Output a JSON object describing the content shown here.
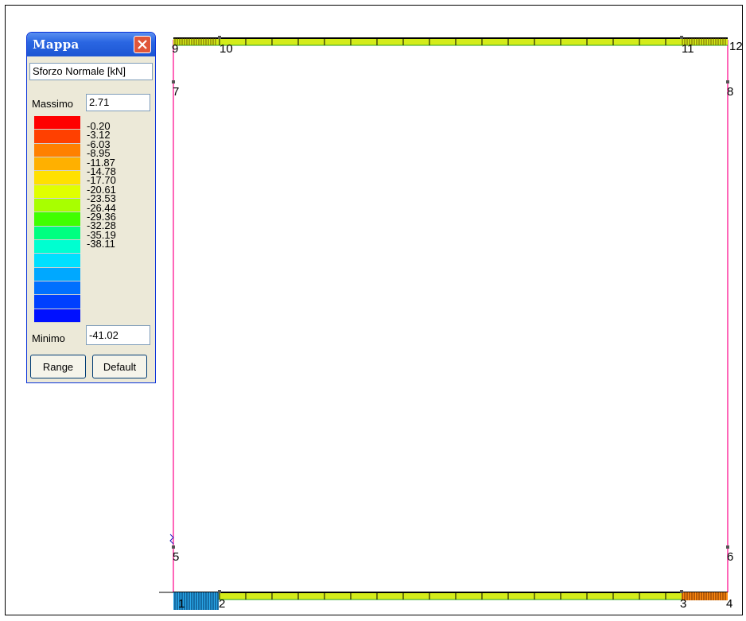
{
  "nodes": [
    "9",
    "10",
    "11",
    "12",
    "7",
    "8",
    "5",
    "6",
    "1",
    "2",
    "3",
    "4"
  ],
  "panel": {
    "title": "Mappa",
    "quantity": "Sforzo Normale [kN]",
    "max_label": "Massimo",
    "max_value": "2.71",
    "min_label": "Minimo",
    "min_value": "-41.02",
    "range_button": "Range",
    "default_button": "Default",
    "scale_values": [
      "-0.20",
      "-3.12",
      "-6.03",
      "-8.95",
      "-11.87",
      "-14.78",
      "-17.70",
      "-20.61",
      "-23.53",
      "-26.44",
      "-29.36",
      "-32.28",
      "-35.19",
      "-38.11"
    ],
    "scale_colors": [
      "#ff0000",
      "#ff4000",
      "#ff8000",
      "#ffb000",
      "#ffe000",
      "#e0ff00",
      "#a8ff00",
      "#40ff00",
      "#00ff80",
      "#00ffd0",
      "#00e0ff",
      "#00a8ff",
      "#0070ff",
      "#0040ff",
      "#0010ff"
    ]
  }
}
